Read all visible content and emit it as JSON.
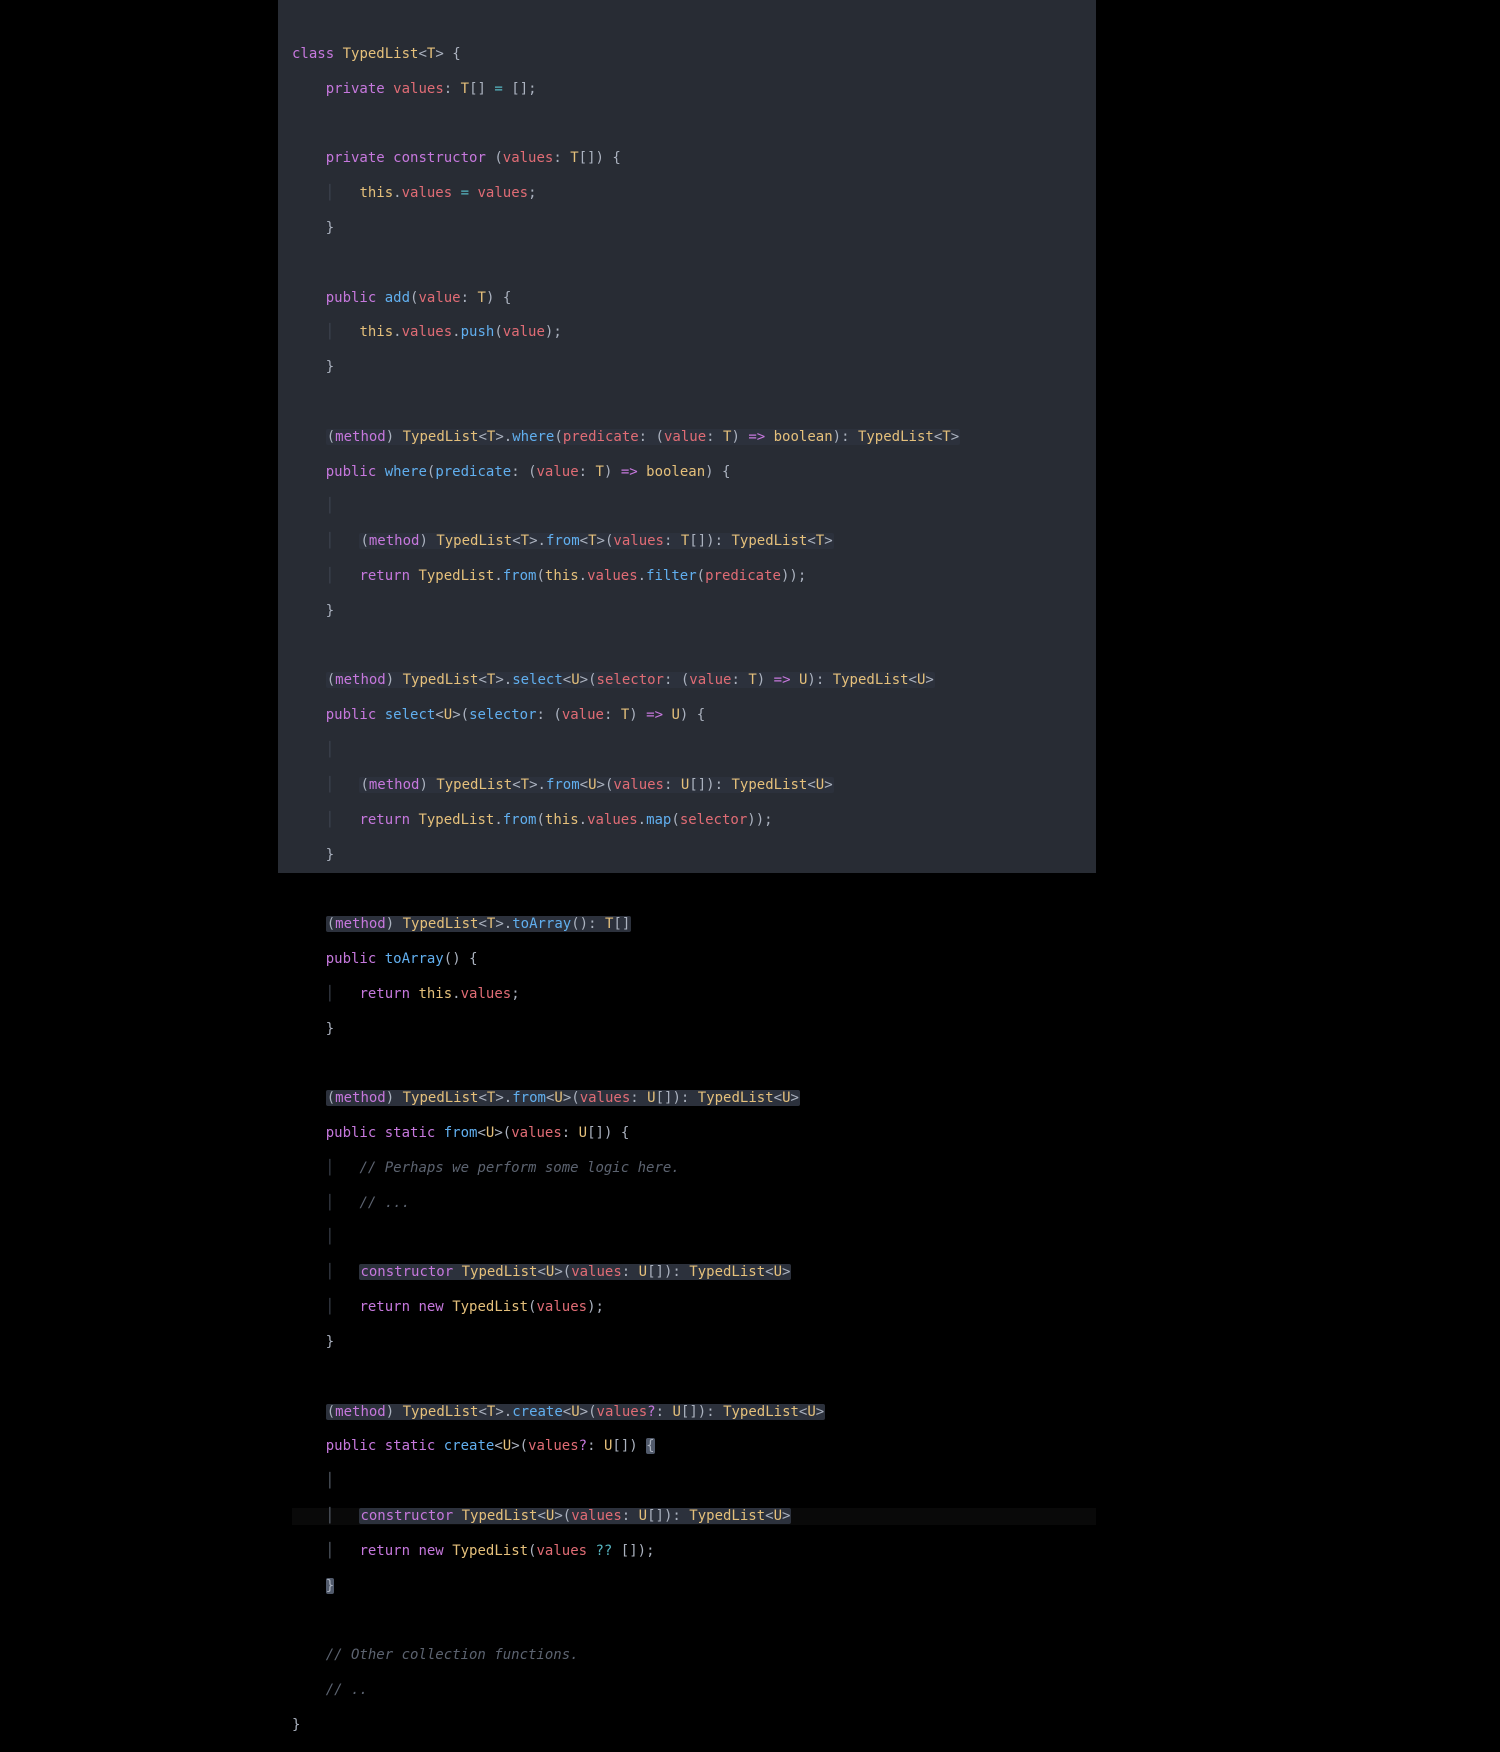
{
  "tokens": {
    "class": "class",
    "TypedList": "TypedList",
    "private": "private",
    "public": "public",
    "static": "static",
    "constructor": "constructor",
    "this": "this",
    "return": "return",
    "new": "new",
    "values": "values",
    "value": "value",
    "predicate": "predicate",
    "selector": "selector",
    "add": "add",
    "push": "push",
    "where": "where",
    "filter": "filter",
    "select": "select",
    "map": "map",
    "toArray": "toArray",
    "from": "from",
    "create": "create",
    "method": "method",
    "boolean": "boolean",
    "T": "T",
    "U": "U",
    "eq": "=",
    "lt": "<",
    "gt": ">",
    "lp": "(",
    "rp": ")",
    "lb": "{",
    "rb": "}",
    "lbr": "[",
    "rbr": "]",
    "colon": ":",
    "semi": ";",
    "comma": ",",
    "dot": ".",
    "arrow": "=>",
    "q": "?",
    "coalesce": "??",
    "sp": " ",
    "ind1": "    ",
    "ind2": "        ",
    "guide": "│",
    "guide3sp": "│   ",
    "c_perhaps": "// Perhaps we perform some logic here.",
    "c_dots": "// ...",
    "c_other": "// Other collection functions.",
    "c_dd": "// .."
  }
}
